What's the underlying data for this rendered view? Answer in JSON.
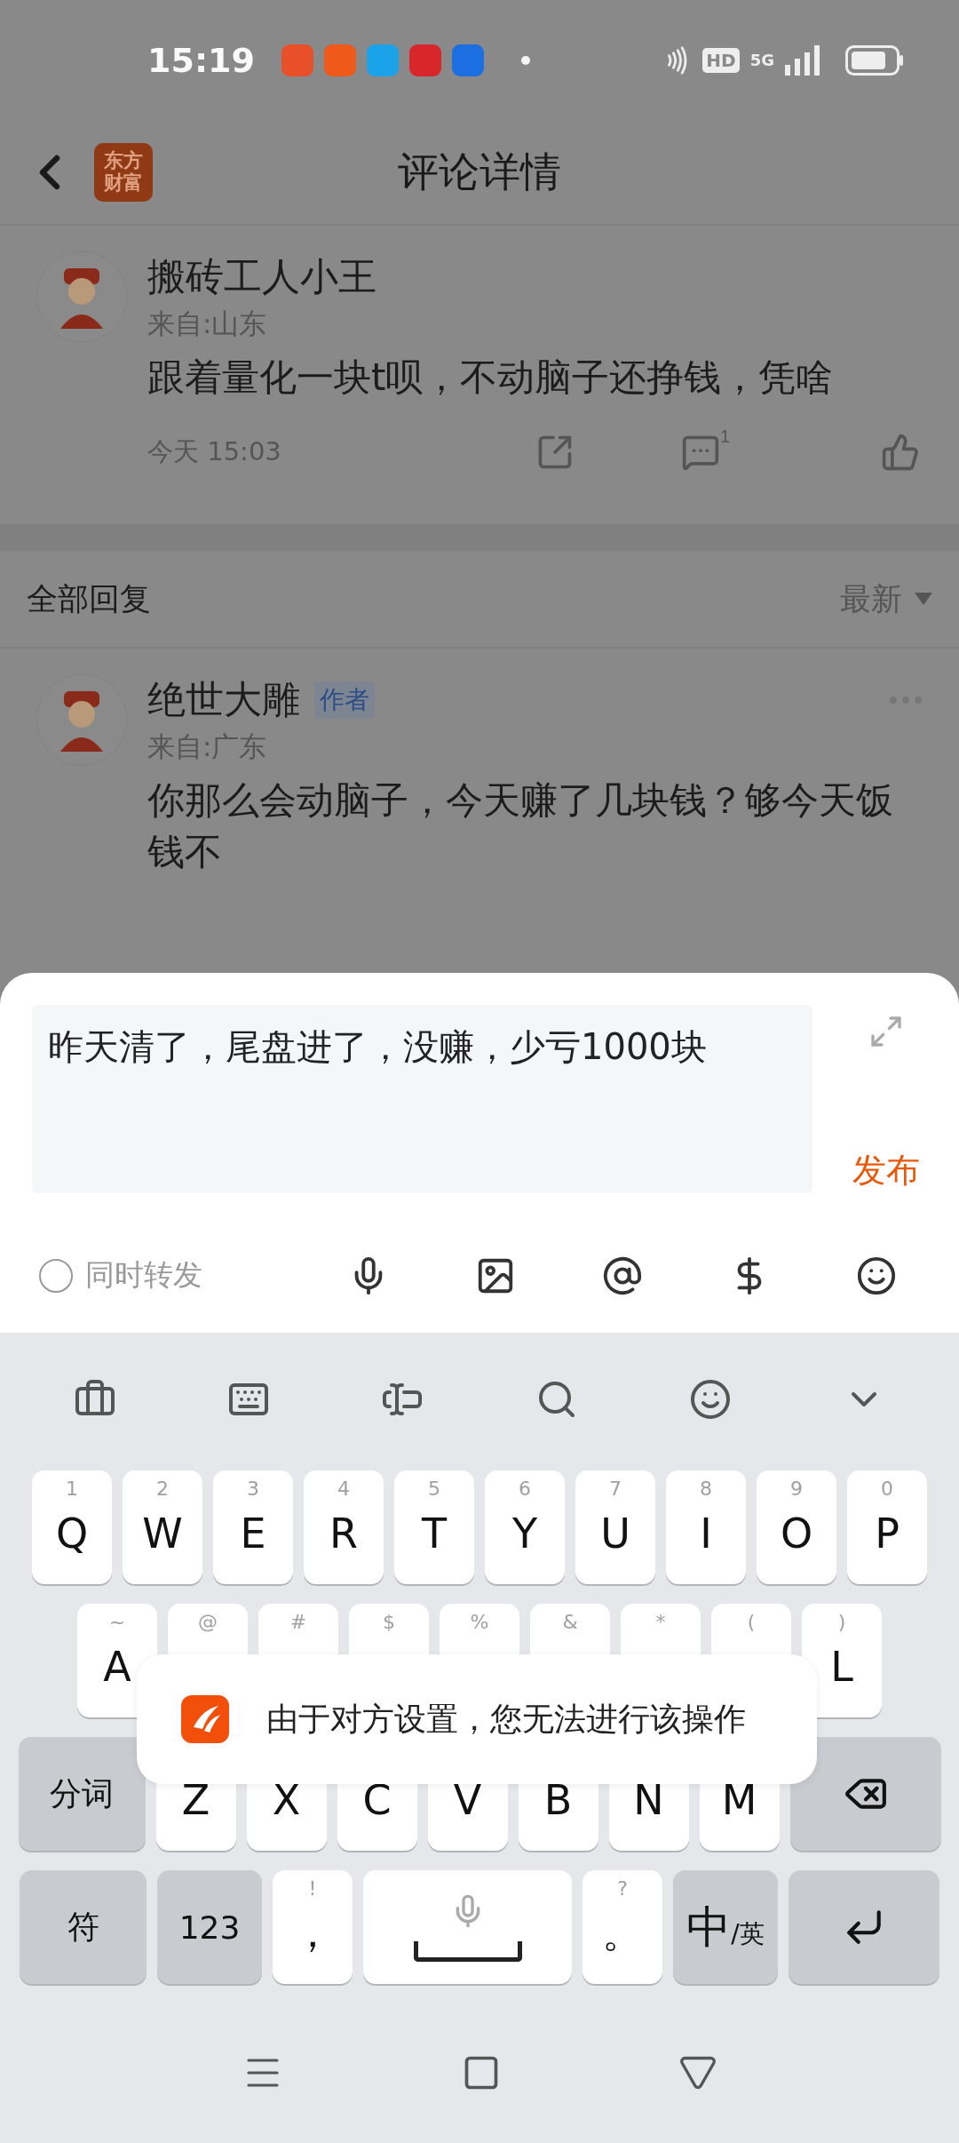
{
  "status_bar": {
    "time": "15:19",
    "hd": "HD",
    "network": "5G"
  },
  "header": {
    "logo_lines": [
      "东方",
      "财富"
    ],
    "title": "评论详情"
  },
  "comment": {
    "author": "搬砖工人小王",
    "location": "来自:山东",
    "text": "跟着量化一块t呗，不动脑子还挣钱，凭啥",
    "time": "今天 15:03",
    "reply_count": "1"
  },
  "replies_header": {
    "title": "全部回复",
    "sort": "最新"
  },
  "replies": [
    {
      "author": "绝世大雕",
      "badge": "作者",
      "location": "来自:广东",
      "text": "你那么会动脑子，今天赚了几块钱？够今天饭钱不"
    }
  ],
  "composer": {
    "value": "昨天清了，尾盘进了，没赚，少亏1000块",
    "submit": "发布",
    "repost": {
      "label": "同时转发",
      "checked": false
    }
  },
  "keyboard": {
    "rows": [
      {
        "keys": [
          {
            "kind": "letter",
            "label": "Q",
            "hint": "1"
          },
          {
            "kind": "letter",
            "label": "W",
            "hint": "2"
          },
          {
            "kind": "letter",
            "label": "E",
            "hint": "3"
          },
          {
            "kind": "letter",
            "label": "R",
            "hint": "4"
          },
          {
            "kind": "letter",
            "label": "T",
            "hint": "5"
          },
          {
            "kind": "letter",
            "label": "Y",
            "hint": "6"
          },
          {
            "kind": "letter",
            "label": "U",
            "hint": "7"
          },
          {
            "kind": "letter",
            "label": "I",
            "hint": "8"
          },
          {
            "kind": "letter",
            "label": "O",
            "hint": "9"
          },
          {
            "kind": "letter",
            "label": "P",
            "hint": "0"
          }
        ]
      },
      {
        "keys": [
          {
            "kind": "letter",
            "label": "A",
            "hint": "~"
          },
          {
            "kind": "letter",
            "hint": "@"
          },
          {
            "kind": "letter",
            "hint": "#"
          },
          {
            "kind": "letter",
            "hint": "$"
          },
          {
            "kind": "letter",
            "hint": "%"
          },
          {
            "kind": "letter",
            "hint": "&"
          },
          {
            "kind": "letter",
            "hint": "*"
          },
          {
            "kind": "letter",
            "hint": "("
          },
          {
            "kind": "letter",
            "label": "L",
            "hint": ")"
          }
        ]
      },
      {
        "keys": [
          {
            "kind": "function",
            "label": "分词"
          },
          {
            "kind": "letter",
            "label": "Z"
          },
          {
            "kind": "letter",
            "label": "X"
          },
          {
            "kind": "letter",
            "label": "C"
          },
          {
            "kind": "letter",
            "label": "V"
          },
          {
            "kind": "letter",
            "label": "B"
          },
          {
            "kind": "letter",
            "label": "N"
          },
          {
            "kind": "letter",
            "label": "M"
          },
          {
            "kind": "backspace"
          }
        ]
      },
      {
        "keys": [
          {
            "kind": "function",
            "label": "符"
          },
          {
            "kind": "mode",
            "label": "123"
          },
          {
            "kind": "letter",
            "label": "，",
            "hint": "!"
          },
          {
            "kind": "space"
          },
          {
            "kind": "letter",
            "label": "。",
            "hint": "?"
          },
          {
            "kind": "lang",
            "label": "中",
            "sub": "/英"
          },
          {
            "kind": "enter"
          }
        ]
      }
    ]
  },
  "toast": {
    "message": "由于对方设置，您无法进行该操作"
  }
}
